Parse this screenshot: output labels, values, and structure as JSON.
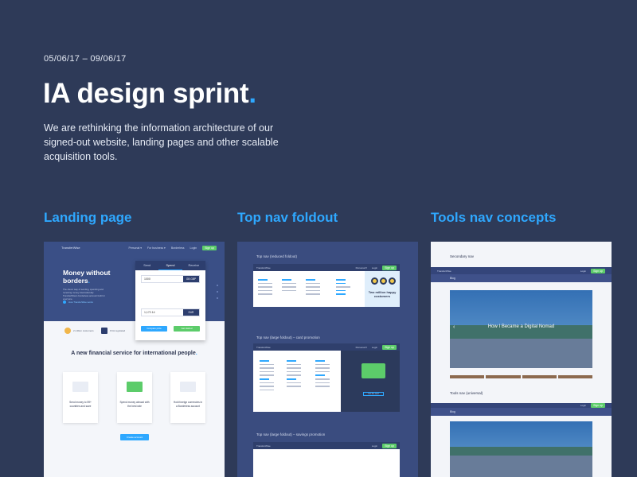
{
  "header": {
    "date_range": "05/06/17 – 09/06/17",
    "title": "IA design sprint",
    "title_dot": ".",
    "intro": "We are rethinking the information architecture of our signed-out website, landing pages and other scalable acquisition tools."
  },
  "columns": [
    {
      "title": "Landing page"
    },
    {
      "title": "Top nav foldout"
    },
    {
      "title": "Tools nav concepts"
    }
  ],
  "landing": {
    "logo": "TransferWise",
    "nav": [
      "Personal ▾",
      "For business ▾",
      "Borderless",
      "Login"
    ],
    "nav_cta": "Sign up",
    "headline": "Money without borders",
    "headline_dot": ".",
    "subtext": "The clever way of sending, spending and receiving money internationally. TransferWise's borderless account built for everyone.",
    "video_link": "How TransferWise works",
    "tabs": [
      "Send",
      "Spend",
      "Receive"
    ],
    "active_tab": "Spend",
    "amount_send": "1000",
    "currency_send": "GB GBP",
    "amount_receive": "1,172.14",
    "currency_receive": "EUR",
    "btn_compare": "Compare price",
    "btn_start": "Get started",
    "btn_start_color": "#5ccc6a",
    "trust_1": "2 million customers",
    "trust_2": "FCA regulated",
    "section_title": "A new financial service for international people",
    "section_dot": ".",
    "features": [
      {
        "caption": "Send money to 59+ countries and save",
        "color": "#e9edf5"
      },
      {
        "caption": "Spend money abroad with the best rate",
        "color": "#5ccc6a"
      },
      {
        "caption": "Hold foreign currencies in a Borderless account",
        "color": "#e9edf5"
      }
    ],
    "cta": "Create account"
  },
  "foldout": {
    "section_1": "Top nav (reduced foldout)",
    "section_2": "Top nav (large foldout) – card promotion",
    "section_3": "Top nav (large foldout) – savings promotion",
    "bar_logo": "TransferWise",
    "bar_links": [
      "Personal ▾",
      "For business ▾",
      "Borderless",
      "Login"
    ],
    "bar_cta": "Sign up",
    "promo_text": "Two million happy customers",
    "card_btn": "Get the card"
  },
  "tools": {
    "secondary_label": "Secondary nav",
    "bar_logo": "TransferWise",
    "bar_links": [
      "Personal ▾",
      "For business ▾",
      "Borderless"
    ],
    "bar_login": "Login",
    "bar_cta": "Sign up",
    "sub_label": "Blog",
    "photo_title": "How I Became a Digital Nomad",
    "universal_label": "Tools nav (universal)",
    "sub_label_2": "Blog"
  }
}
